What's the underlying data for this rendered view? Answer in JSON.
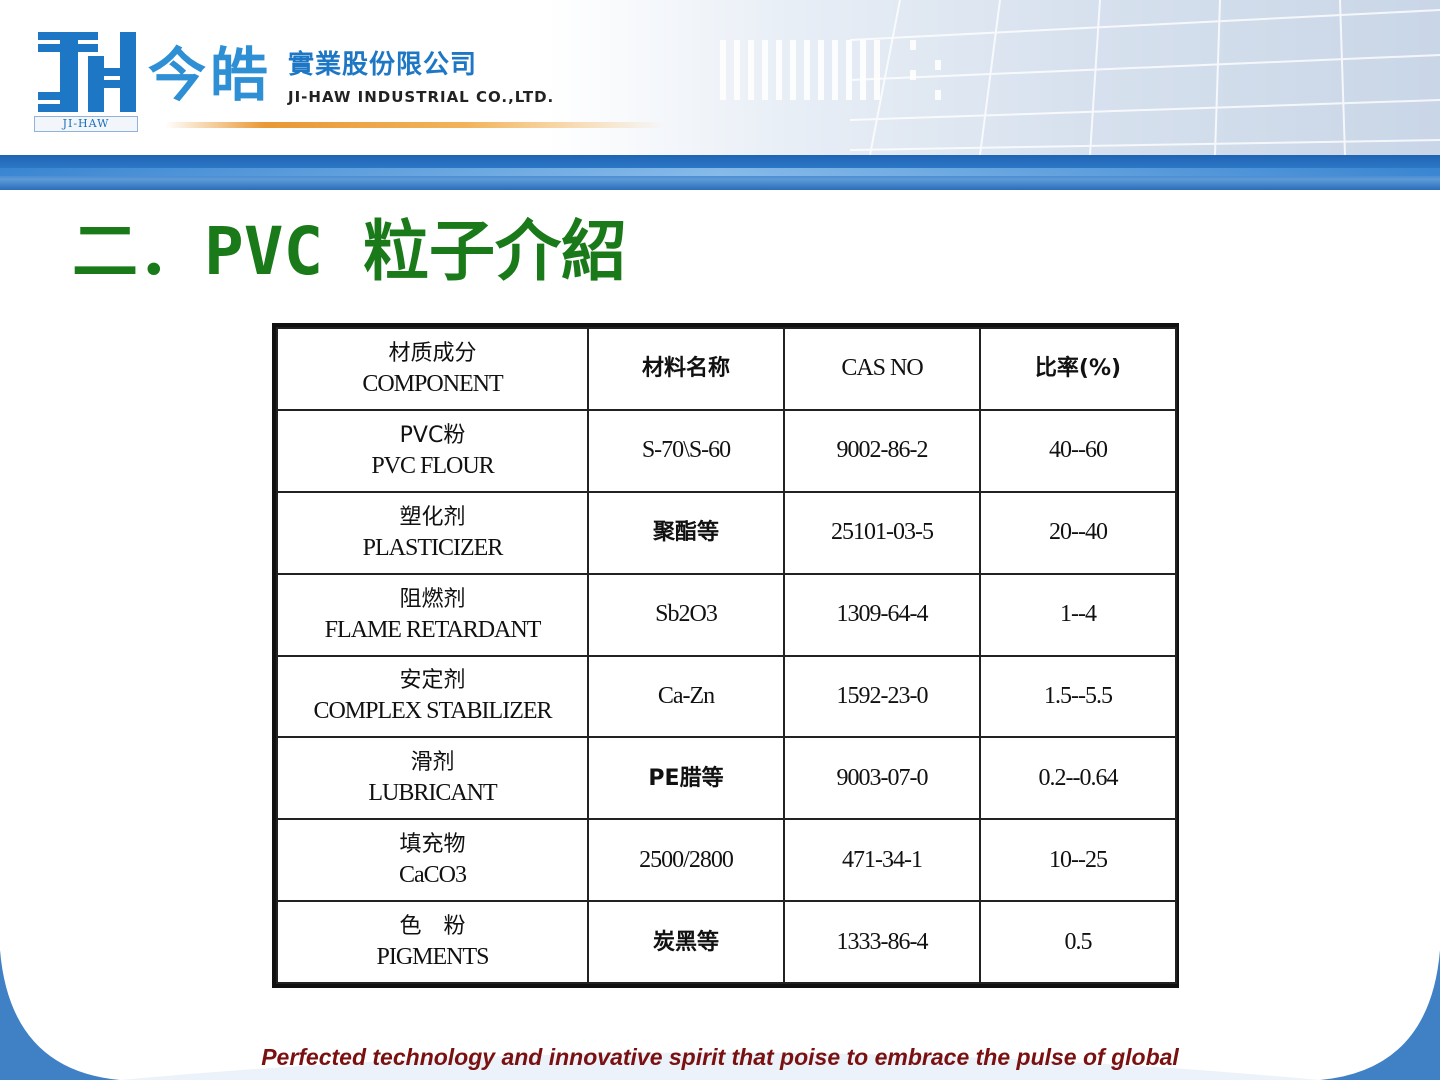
{
  "header": {
    "logo_sub": "JI-HAW",
    "brand_cn": "今皓",
    "company_cn": "實業股份限公司",
    "company_en": "JI-HAW INDUSTRIAL CO.,LTD."
  },
  "title": "二．PVC 粒子介紹",
  "table": {
    "headers": {
      "component_cn": "材质成分",
      "component_en": "COMPONENT",
      "material": "材料名称",
      "cas": "CAS NO",
      "ratio": "比率(%)"
    },
    "rows": [
      {
        "cn": "PVC粉",
        "en": "PVC FLOUR",
        "material": "S-70\\S-60",
        "cas": "9002-86-2",
        "ratio": "40--60"
      },
      {
        "cn": "塑化剂",
        "en": "PLASTICIZER",
        "material": "聚酯等",
        "cas": "25101-03-5",
        "ratio": "20--40"
      },
      {
        "cn": "阻燃剂",
        "en": "FLAME RETARDANT",
        "material": "Sb2O3",
        "cas": "1309-64-4",
        "ratio": "1--4"
      },
      {
        "cn": "安定剂",
        "en": "COMPLEX STABILIZER",
        "material": "Ca-Zn",
        "cas": "1592-23-0",
        "ratio": "1.5--5.5"
      },
      {
        "cn": "滑剂",
        "en": "LUBRICANT",
        "material": "PE腊等",
        "cas": "9003-07-0",
        "ratio": "0.2--0.64"
      },
      {
        "cn": "填充物",
        "en": "CaCO3",
        "material": "2500/2800",
        "cas": "471-34-1",
        "ratio": "10--25"
      },
      {
        "cn": "色　粉",
        "en": "PIGMENTS",
        "material": "炭黑等",
        "cas": "1333-86-4",
        "ratio": "0.5"
      }
    ]
  },
  "footer": {
    "slogan": "Perfected technology and innovative spirit that poise to embrace the pulse of global"
  },
  "colors": {
    "title": "#1a7a1a",
    "brand_blue": "#2e8fd4",
    "stripe_blue": "#2a6db8",
    "slogan": "#7a1010",
    "accent_orange": "#e99833"
  }
}
